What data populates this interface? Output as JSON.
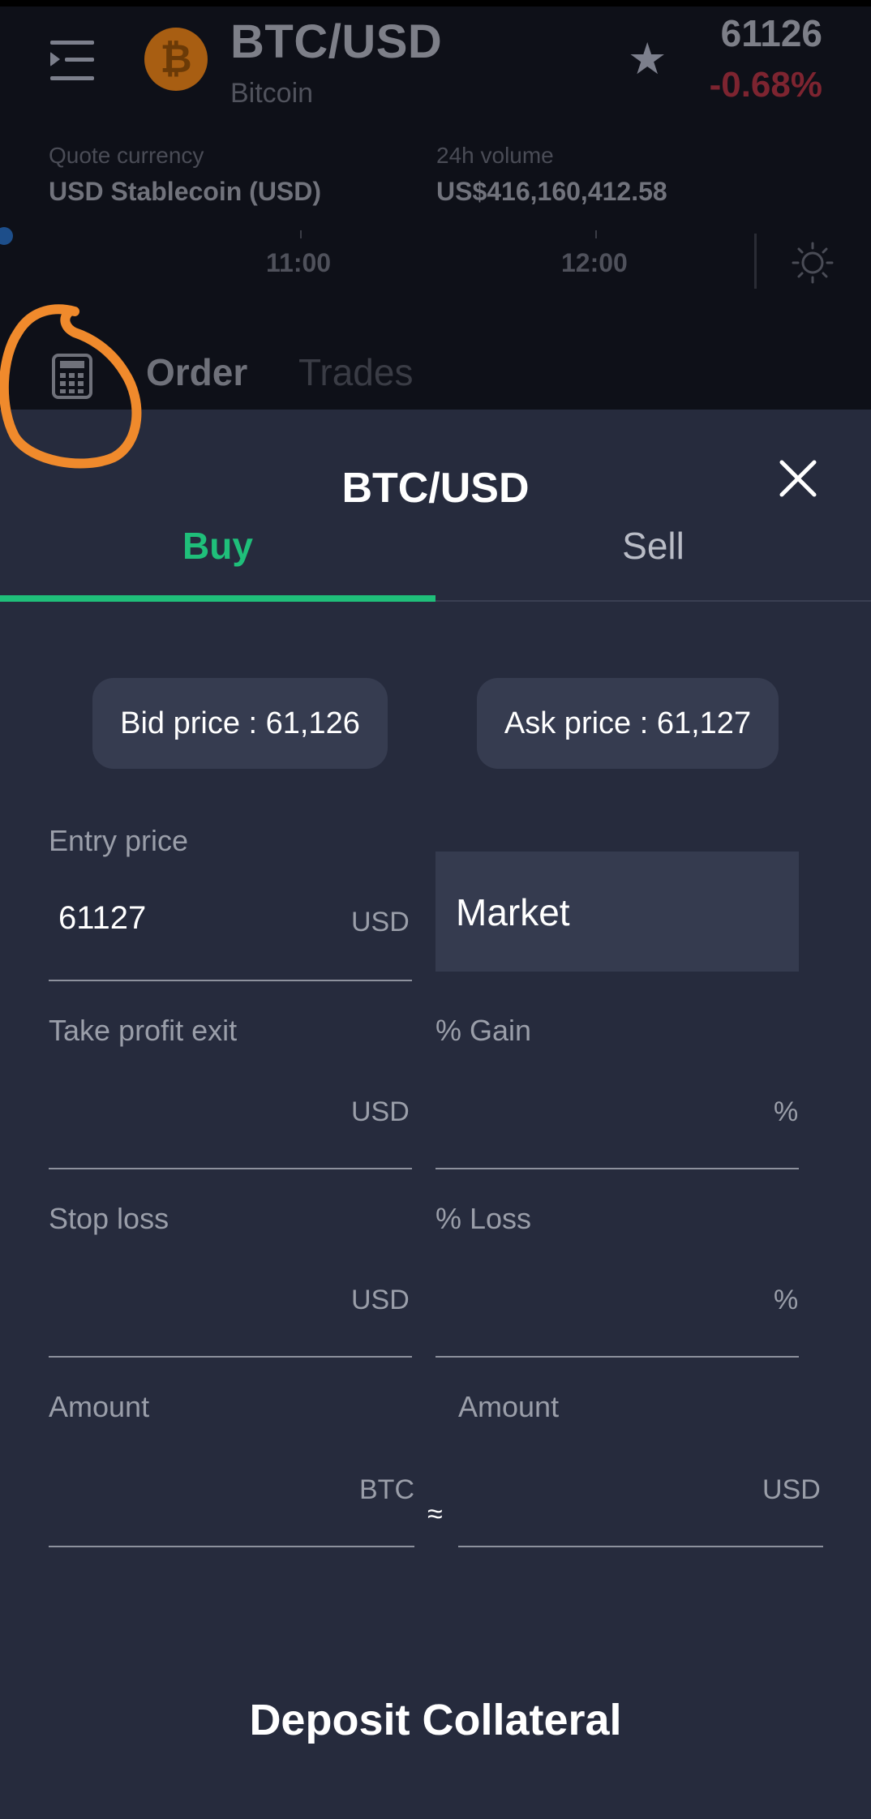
{
  "header": {
    "pair": "BTC/USD",
    "coin_name": "Bitcoin",
    "coin_symbol": "₿",
    "price": "61126",
    "change": "-0.68%",
    "quote_currency_label": "Quote currency",
    "quote_currency_value": "USD Stablecoin (USD)",
    "volume_label": "24h volume",
    "volume_value": "US$416,160,412.58"
  },
  "chart": {
    "times": [
      "11:00",
      "12:00"
    ]
  },
  "bottom_tabs": {
    "order": "Order",
    "trades": "Trades"
  },
  "modal": {
    "title": "BTC/USD",
    "tabs": {
      "buy": "Buy",
      "sell": "Sell",
      "active": "Buy"
    },
    "bid_price": "Bid price : 61,126",
    "ask_price": "Ask price : 61,127",
    "entry_price": {
      "label": "Entry price",
      "value": "61127",
      "unit": "USD"
    },
    "order_type": "Market",
    "take_profit": {
      "label": "Take profit exit",
      "unit": "USD"
    },
    "gain": {
      "label": "% Gain",
      "unit": "%"
    },
    "stop_loss": {
      "label": "Stop loss",
      "unit": "USD"
    },
    "loss": {
      "label": "% Loss",
      "unit": "%"
    },
    "amount_btc": {
      "label": "Amount",
      "unit": "BTC"
    },
    "amount_usd": {
      "label": "Amount",
      "unit": "USD"
    },
    "approx_symbol": "≈",
    "deposit_button": "Deposit Collateral"
  },
  "colors": {
    "buy_accent": "#1fbf7a",
    "negative": "#7d2430",
    "sheet_bg": "#262b3d",
    "annotation": "#f08a2c"
  }
}
